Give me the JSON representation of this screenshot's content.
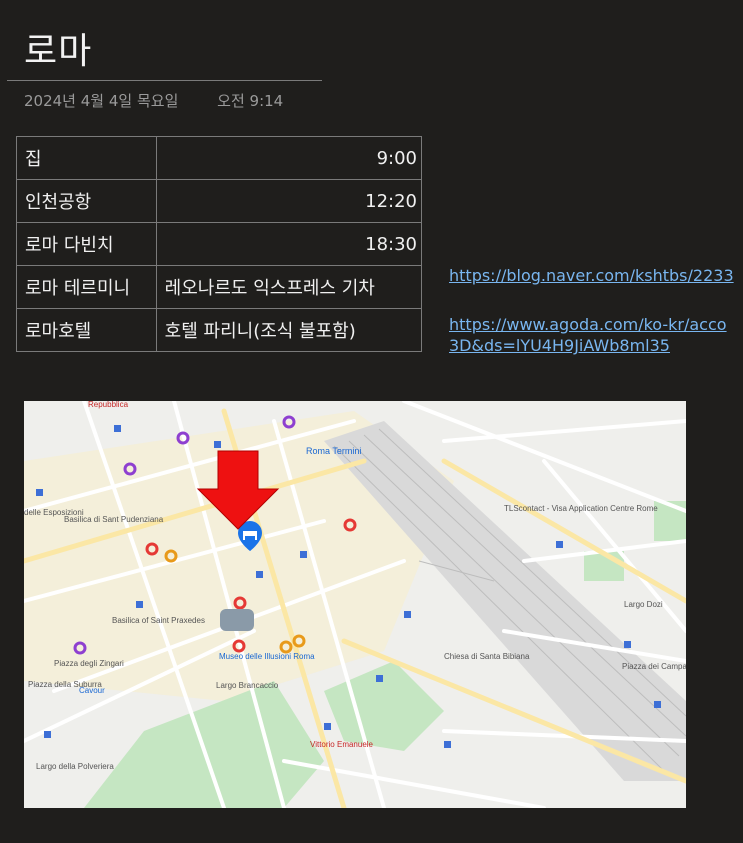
{
  "note": {
    "title": "로마",
    "date": "2024년 4월 4일 목요일",
    "time": "오전 9:14"
  },
  "itinerary": [
    {
      "place": "집",
      "detail": "9:00"
    },
    {
      "place": "인천공항",
      "detail": "12:20"
    },
    {
      "place": "로마 다빈치",
      "detail": "18:30"
    },
    {
      "place": "로마 테르미니",
      "detail": "레오나르도 익스프레스 기차"
    },
    {
      "place": "로마호텔",
      "detail": "호텔 파리니(조식 불포함)"
    }
  ],
  "links": [
    {
      "line1": "https://blog.naver.com/kshtbs/2233"
    },
    {
      "line1": "https://www.agoda.com/ko-kr/acco",
      "line2": "3D&ds=lYU4H9JiAWb8ml35"
    }
  ],
  "map": {
    "labels": {
      "termini": "Roma Termini",
      "basilica_pudenziana": "Basilica di Sant Pudenziana",
      "basilica_prassede": "Basilica of Saint Praxedes",
      "piazza_zingari": "Piazza degli Zingari",
      "cavour": "Cavour",
      "piazza_suburra": "Piazza della Suburra",
      "vittorio": "Vittorio Emanuele",
      "largo_dozi": "Largo Dozi",
      "largo_brancaccio": "Largo Brancaccio",
      "santa_bibiana": "Chiesa di Santa Bibiana",
      "vfs": "TLScontact - Visa Application Centre Rome",
      "museo": "Museo delle Illusioni Roma",
      "repubblica": "Repubblica",
      "esposizioni": "delle Esposizioni",
      "piazza_campani": "Piazza dei Campani",
      "largo_poliveria": "Largo della Polveriera"
    },
    "colors": {
      "land": "#efefec",
      "road": "#ffffff",
      "major_road": "#fbe7a5",
      "park": "#c5e6c2",
      "rail": "#d3d3d3",
      "arrow": "#ee1111",
      "hotel_pin": "#1a73e8",
      "transit": "#3d6fd6",
      "poi_purple": "#8e3fd0",
      "poi_orange": "#e89a1a",
      "poi_red": "#e53935"
    }
  }
}
